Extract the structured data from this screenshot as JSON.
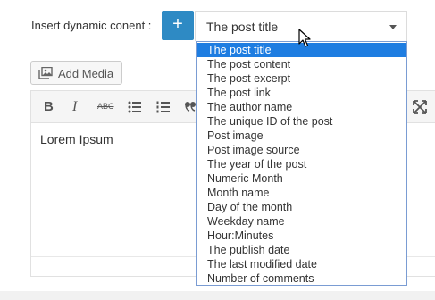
{
  "dynamic": {
    "label": "Insert dynamic conent :",
    "plus_label": "+",
    "selected": "The post title",
    "options": [
      "The post title",
      "The post content",
      "The post excerpt",
      "The post link",
      "The author name",
      "The unique ID of the post",
      "Post image",
      "Post image source",
      "The year of the post",
      "Numeric Month",
      "Month name",
      "Day of the month",
      "Weekday name",
      "Hour:Minutes",
      "The publish date",
      "The last modified date",
      "Number of comments"
    ]
  },
  "media": {
    "add_label": "Add Media",
    "icon": "add-media-icon"
  },
  "toolbar": {
    "bold_label": "B",
    "italic_label": "I",
    "strike_label": "ABC",
    "icons": [
      "bold-icon",
      "italic-icon",
      "strikethrough-icon",
      "bullet-list-icon",
      "numbered-list-icon",
      "blockquote-icon",
      "fullscreen-icon"
    ]
  },
  "editor": {
    "content": "Lorem Ipsum"
  },
  "colors": {
    "accent": "#2e8ac4",
    "selection": "#1e7de1",
    "dropdown_border": "#7a9cd3"
  }
}
